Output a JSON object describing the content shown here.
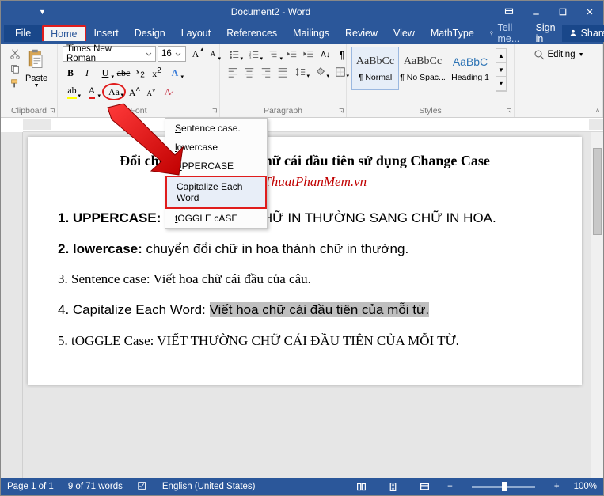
{
  "title": "Document2 - Word",
  "quickaccess": {
    "save": "save-icon",
    "undo": "undo-icon",
    "redo": "redo-icon",
    "touch": "touch-icon"
  },
  "windowactions": {
    "ribbon": "ribbon-minimize",
    "min": "minimize",
    "restore": "restore",
    "close": "close"
  },
  "menu": {
    "file": "File",
    "home": "Home",
    "insert": "Insert",
    "design": "Design",
    "layout": "Layout",
    "references": "References",
    "mailings": "Mailings",
    "review": "Review",
    "view": "View",
    "mathtype": "MathType",
    "tellme": "Tell me...",
    "signin": "Sign in",
    "share": "Share"
  },
  "ribbon_groups": {
    "clipboard": {
      "label": "Clipboard",
      "paste": "Paste"
    },
    "font": {
      "label": "Font",
      "fontname": "Times New Roman",
      "fontsize": "16",
      "changecase_tip": "Aa"
    },
    "paragraph": {
      "label": "Paragraph"
    },
    "styles": {
      "label": "Styles",
      "items": [
        {
          "preview": "AaBbCc",
          "name": "¶ Normal"
        },
        {
          "preview": "AaBbCc",
          "name": "¶ No Spac..."
        },
        {
          "preview": "AaBbC",
          "name": "Heading 1"
        }
      ]
    },
    "editing": {
      "label": "Editing"
    }
  },
  "changecase_menu": {
    "sentence": "Sentence case.",
    "lower": "lowercase",
    "upper": "UPPERCASE",
    "capitalize": "Capitalize Each Word",
    "toggle": "tOGGLE cASE"
  },
  "document": {
    "heading": "Đổi chữ thường thành chữ cái đầu tiên sử dụng Change Case",
    "link": "ThuThuatPhanMem.vn",
    "p1_b": "1. UPPERCASE:",
    "p1": " CHUYỂN ĐỔI CHỮ IN THƯỜNG SANG CHỮ IN HOA.",
    "p2_b": "2. lowercase:",
    "p2": " chuyển đổi chữ in hoa thành chữ in thường.",
    "p3": "3. Sentence case: Viết hoa chữ cái đầu của câu.",
    "p4a": "4. Capitalize Each Word: ",
    "p4b": "Viết hoa chữ cái đầu tiên của mỗi từ.",
    "p5": "5. tOGGLE Case: VIẾT THƯỜNG CHỮ CÁI ĐẦU TIÊN CỦA MỖI TỪ."
  },
  "statusbar": {
    "page": "Page 1 of 1",
    "words": "9 of 71 words",
    "lang": "English (United States)",
    "zoom": "100%"
  }
}
